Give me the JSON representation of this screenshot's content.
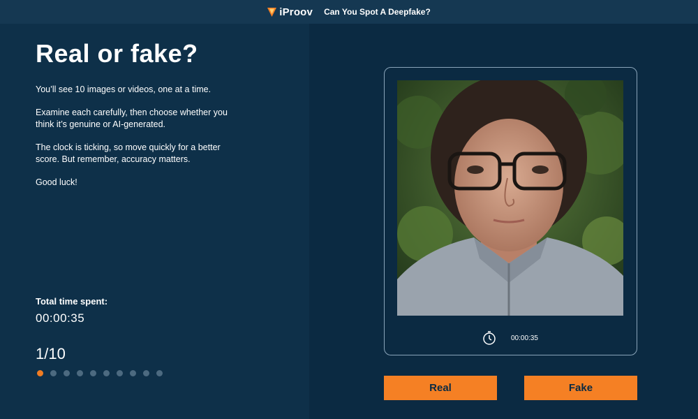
{
  "header": {
    "logo_text": "iProov",
    "title": "Can You Spot A Deepfake?"
  },
  "intro": {
    "heading": "Real or fake?",
    "paragraphs": [
      "You’ll see 10 images or videos, one at a time.",
      "Examine each carefully, then choose whether you think it’s genuine or AI-generated.",
      "The clock is ticking, so move quickly for a better score. But remember, accuracy matters.",
      "Good luck!"
    ]
  },
  "stats": {
    "time_label": "Total time spent:",
    "time_value": "00:00:35",
    "progress": "1/10",
    "current_index": 1,
    "total": 10
  },
  "media": {
    "timer_icon": "stopwatch-icon",
    "timer_value": "00:00:35"
  },
  "actions": {
    "real_label": "Real",
    "fake_label": "Fake"
  },
  "colors": {
    "accent": "#f58024",
    "background": "#0c2d45",
    "active_dot": "#f07c22",
    "inactive_dot": "#4c6a80"
  }
}
